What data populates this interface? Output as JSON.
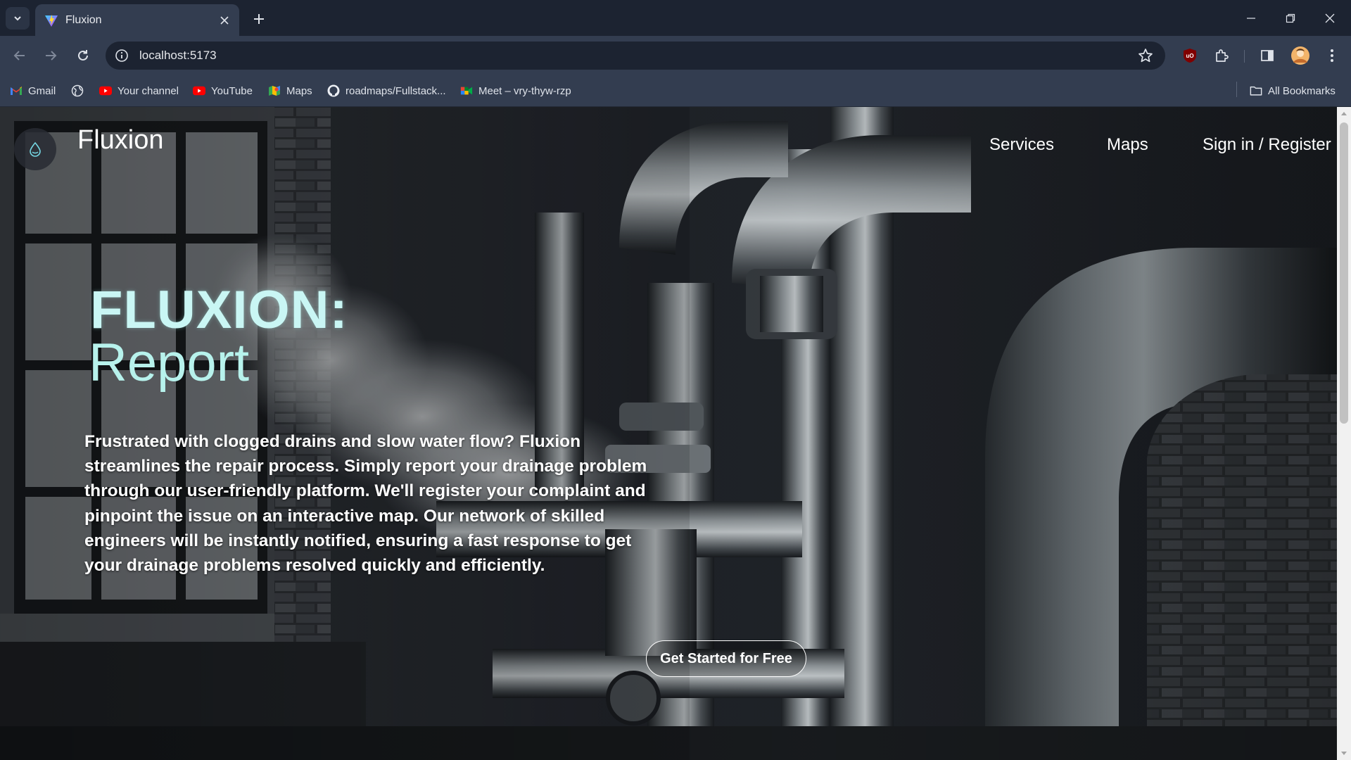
{
  "browser": {
    "tab_title": "Fluxion",
    "url": "localhost:5173",
    "bookmarks": [
      {
        "label": "Gmail",
        "icon": "gmail-icon"
      },
      {
        "label": "",
        "icon": "globe-icon"
      },
      {
        "label": "Your channel",
        "icon": "youtube-icon"
      },
      {
        "label": "YouTube",
        "icon": "youtube-icon"
      },
      {
        "label": "Maps",
        "icon": "maps-icon"
      },
      {
        "label": "roadmaps/Fullstack...",
        "icon": "github-icon"
      },
      {
        "label": "Meet – vry-thyw-rzp",
        "icon": "meet-icon"
      }
    ],
    "all_bookmarks_label": "All Bookmarks",
    "colors": {
      "chrome_dark": "#1c2331",
      "chrome_light": "#333d50"
    }
  },
  "site": {
    "brand": "Fluxion",
    "nav": {
      "services": "Services",
      "maps": "Maps",
      "auth": "Sign in / Register"
    },
    "hero": {
      "title": "FLUXION:",
      "subtitle": "Report",
      "body": "Frustrated with clogged drains and slow water flow? Fluxion streamlines the repair process. Simply report your drainage problem through our user-friendly platform. We'll register your complaint and pinpoint the issue on an interactive map. Our network of skilled engineers will be instantly notified, ensuring a fast response to get your drainage problems resolved quickly and efficiently.",
      "cta": "Get Started for Free"
    },
    "colors": {
      "title_accent": "#c9f6f4",
      "text": "#ffffff"
    }
  }
}
